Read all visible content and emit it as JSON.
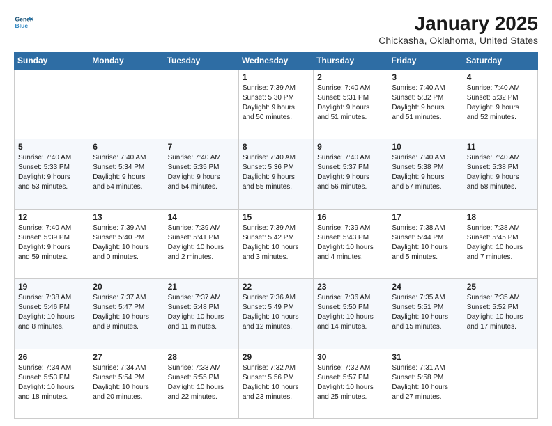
{
  "header": {
    "logo_line1": "General",
    "logo_line2": "Blue",
    "title": "January 2025",
    "subtitle": "Chickasha, Oklahoma, United States"
  },
  "days_of_week": [
    "Sunday",
    "Monday",
    "Tuesday",
    "Wednesday",
    "Thursday",
    "Friday",
    "Saturday"
  ],
  "weeks": [
    [
      {
        "day": "",
        "info": ""
      },
      {
        "day": "",
        "info": ""
      },
      {
        "day": "",
        "info": ""
      },
      {
        "day": "1",
        "info": "Sunrise: 7:39 AM\nSunset: 5:30 PM\nDaylight: 9 hours\nand 50 minutes."
      },
      {
        "day": "2",
        "info": "Sunrise: 7:40 AM\nSunset: 5:31 PM\nDaylight: 9 hours\nand 51 minutes."
      },
      {
        "day": "3",
        "info": "Sunrise: 7:40 AM\nSunset: 5:32 PM\nDaylight: 9 hours\nand 51 minutes."
      },
      {
        "day": "4",
        "info": "Sunrise: 7:40 AM\nSunset: 5:32 PM\nDaylight: 9 hours\nand 52 minutes."
      }
    ],
    [
      {
        "day": "5",
        "info": "Sunrise: 7:40 AM\nSunset: 5:33 PM\nDaylight: 9 hours\nand 53 minutes."
      },
      {
        "day": "6",
        "info": "Sunrise: 7:40 AM\nSunset: 5:34 PM\nDaylight: 9 hours\nand 54 minutes."
      },
      {
        "day": "7",
        "info": "Sunrise: 7:40 AM\nSunset: 5:35 PM\nDaylight: 9 hours\nand 54 minutes."
      },
      {
        "day": "8",
        "info": "Sunrise: 7:40 AM\nSunset: 5:36 PM\nDaylight: 9 hours\nand 55 minutes."
      },
      {
        "day": "9",
        "info": "Sunrise: 7:40 AM\nSunset: 5:37 PM\nDaylight: 9 hours\nand 56 minutes."
      },
      {
        "day": "10",
        "info": "Sunrise: 7:40 AM\nSunset: 5:38 PM\nDaylight: 9 hours\nand 57 minutes."
      },
      {
        "day": "11",
        "info": "Sunrise: 7:40 AM\nSunset: 5:38 PM\nDaylight: 9 hours\nand 58 minutes."
      }
    ],
    [
      {
        "day": "12",
        "info": "Sunrise: 7:40 AM\nSunset: 5:39 PM\nDaylight: 9 hours\nand 59 minutes."
      },
      {
        "day": "13",
        "info": "Sunrise: 7:39 AM\nSunset: 5:40 PM\nDaylight: 10 hours\nand 0 minutes."
      },
      {
        "day": "14",
        "info": "Sunrise: 7:39 AM\nSunset: 5:41 PM\nDaylight: 10 hours\nand 2 minutes."
      },
      {
        "day": "15",
        "info": "Sunrise: 7:39 AM\nSunset: 5:42 PM\nDaylight: 10 hours\nand 3 minutes."
      },
      {
        "day": "16",
        "info": "Sunrise: 7:39 AM\nSunset: 5:43 PM\nDaylight: 10 hours\nand 4 minutes."
      },
      {
        "day": "17",
        "info": "Sunrise: 7:38 AM\nSunset: 5:44 PM\nDaylight: 10 hours\nand 5 minutes."
      },
      {
        "day": "18",
        "info": "Sunrise: 7:38 AM\nSunset: 5:45 PM\nDaylight: 10 hours\nand 7 minutes."
      }
    ],
    [
      {
        "day": "19",
        "info": "Sunrise: 7:38 AM\nSunset: 5:46 PM\nDaylight: 10 hours\nand 8 minutes."
      },
      {
        "day": "20",
        "info": "Sunrise: 7:37 AM\nSunset: 5:47 PM\nDaylight: 10 hours\nand 9 minutes."
      },
      {
        "day": "21",
        "info": "Sunrise: 7:37 AM\nSunset: 5:48 PM\nDaylight: 10 hours\nand 11 minutes."
      },
      {
        "day": "22",
        "info": "Sunrise: 7:36 AM\nSunset: 5:49 PM\nDaylight: 10 hours\nand 12 minutes."
      },
      {
        "day": "23",
        "info": "Sunrise: 7:36 AM\nSunset: 5:50 PM\nDaylight: 10 hours\nand 14 minutes."
      },
      {
        "day": "24",
        "info": "Sunrise: 7:35 AM\nSunset: 5:51 PM\nDaylight: 10 hours\nand 15 minutes."
      },
      {
        "day": "25",
        "info": "Sunrise: 7:35 AM\nSunset: 5:52 PM\nDaylight: 10 hours\nand 17 minutes."
      }
    ],
    [
      {
        "day": "26",
        "info": "Sunrise: 7:34 AM\nSunset: 5:53 PM\nDaylight: 10 hours\nand 18 minutes."
      },
      {
        "day": "27",
        "info": "Sunrise: 7:34 AM\nSunset: 5:54 PM\nDaylight: 10 hours\nand 20 minutes."
      },
      {
        "day": "28",
        "info": "Sunrise: 7:33 AM\nSunset: 5:55 PM\nDaylight: 10 hours\nand 22 minutes."
      },
      {
        "day": "29",
        "info": "Sunrise: 7:32 AM\nSunset: 5:56 PM\nDaylight: 10 hours\nand 23 minutes."
      },
      {
        "day": "30",
        "info": "Sunrise: 7:32 AM\nSunset: 5:57 PM\nDaylight: 10 hours\nand 25 minutes."
      },
      {
        "day": "31",
        "info": "Sunrise: 7:31 AM\nSunset: 5:58 PM\nDaylight: 10 hours\nand 27 minutes."
      },
      {
        "day": "",
        "info": ""
      }
    ]
  ]
}
